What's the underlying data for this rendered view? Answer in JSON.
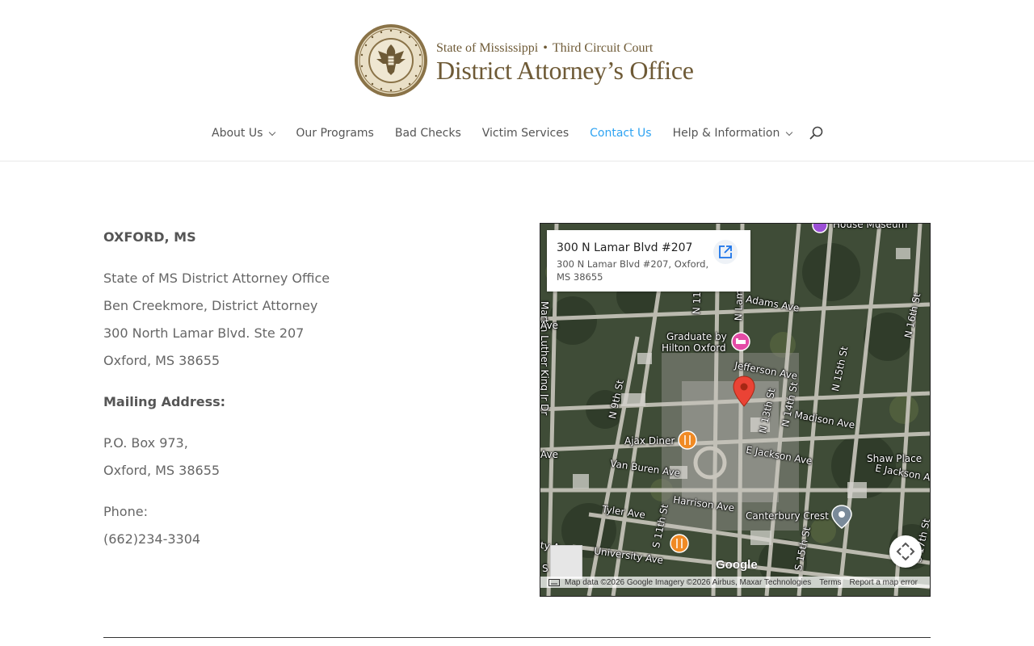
{
  "header": {
    "logo": {
      "top_line_left": "State of Mississippi",
      "separator": "•",
      "top_line_right": "Third Circuit Court",
      "main_line": "District Attorney’s Office",
      "seal_text": "THE GREAT SEAL OF THE STATE OF MISSISSIPPI",
      "brand_color": "#6e5a36"
    },
    "nav": [
      {
        "label": "About Us",
        "has_dropdown": true
      },
      {
        "label": "Our Programs",
        "has_dropdown": false
      },
      {
        "label": "Bad Checks",
        "has_dropdown": false
      },
      {
        "label": "Victim Services",
        "has_dropdown": false
      },
      {
        "label": "Contact Us",
        "has_dropdown": false,
        "active": true
      },
      {
        "label": "Help & Information",
        "has_dropdown": true
      }
    ],
    "active_color": "#2ea3f2",
    "search_icon": "search-icon"
  },
  "contact": {
    "location_heading": "OXFORD, MS",
    "office_name": "State of MS District Attorney Office",
    "attorney": "Ben Creekmore, District Attorney",
    "street": "300 North Lamar Blvd. Ste 207",
    "city_state_zip": "Oxford, MS 38655",
    "mailing_heading": "Mailing Address:",
    "po_box": "P.O. Box 973,",
    "mailing_city": "Oxford, MS 38655",
    "phone_label": "Phone:",
    "phone": "(662)234-3304"
  },
  "map": {
    "card_title": "300 N Lamar Blvd #207",
    "card_address": "300 N Lamar Blvd #207, Oxford, MS 38655",
    "labels": {
      "house_museum": "House Museum",
      "mlk_dr": "Martin Luther King Jr Dr",
      "ave_left": "Ave",
      "adams_ave": "Adams Ave",
      "n_lamar": "N Lamar",
      "n_11th": "N 11",
      "graduate": "Graduate by",
      "hilton": "Hilton Oxford",
      "jefferson_ave": "Jefferson Ave",
      "n_13th": "N 13th St",
      "n_14th": "N 14th St",
      "n_15th": "N 15th St",
      "n_16th": "N 16th St",
      "n_9th": "N 9th St",
      "madison_ave": "Madison Ave",
      "ajax_diner": "Ajax Diner",
      "e_jackson_ave": "E Jackson Ave",
      "shaw_place": "Shaw Place",
      "e_jackson_right": "E Jackson Av",
      "ave_left2": "Ave",
      "van_buren": "Van Buren Ave",
      "harrison": "Harrison Ave",
      "tyler": "Tyler Ave",
      "s_11th": "S 11th St",
      "canterbury": "Canterbury Crest",
      "university": "University Ave",
      "s_15th": "S 15th St",
      "s_17th": "S 17th St",
      "university_left": "ersity Ave",
      "s_left": "S"
    },
    "google_logo": "Google",
    "attribution": "Map data ©2026 Google Imagery ©2026 Airbus, Maxar Technologies",
    "terms": "Terms",
    "report": "Report a map error"
  }
}
